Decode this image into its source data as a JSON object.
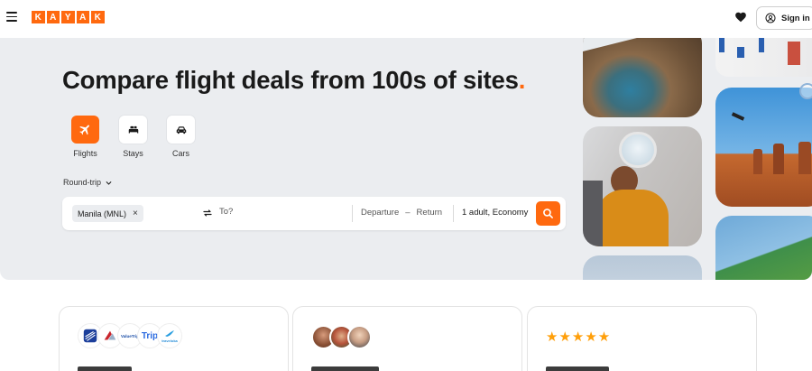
{
  "header": {
    "logo_letters": [
      "K",
      "A",
      "Y",
      "A",
      "K"
    ],
    "signin_label": "Sign in"
  },
  "hero": {
    "title": "Compare flight deals from 100s of sites",
    "title_dot": ".",
    "verticals": [
      {
        "label": "Flights",
        "icon": "plane-icon",
        "active": true
      },
      {
        "label": "Stays",
        "icon": "bed-icon",
        "active": false
      },
      {
        "label": "Cars",
        "icon": "car-icon",
        "active": false
      }
    ],
    "trip_type": "Round-trip",
    "search": {
      "origin": "Manila (MNL)",
      "destination_placeholder": "To?",
      "departure": "Departure",
      "dash": "–",
      "return": "Return",
      "travelers": "1 adult, Economy"
    }
  },
  "cards": {
    "partner_logos": [
      "United",
      "American",
      "ValueTrip",
      "Trip",
      "traveloka"
    ],
    "rating_stars": "★★★★★"
  },
  "colors": {
    "brand": "#ff690f",
    "hero_bg": "#ebedf0"
  }
}
